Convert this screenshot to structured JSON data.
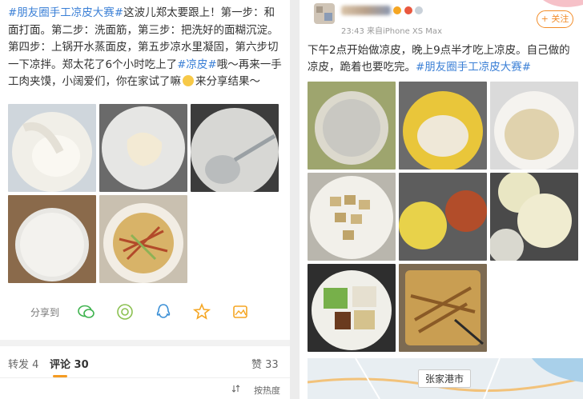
{
  "left_post": {
    "tag": "#朋友圈手工凉皮大赛#",
    "text_1": "这波儿郑太要跟上！第一步：和面打面。第二步：洗面筋，第三步：把洗好的面糊沉淀。第四步：上锅开水蒸面皮，第五步凉水里凝固，第六步切一下凉拌。郑太花了6个小时吃上了",
    "tag_2": "#凉皮#",
    "text_2": "哦～再来一手工肉夹馍，小阔爱们，你在家试了嘛",
    "text_3": "来分享结果～"
  },
  "share": {
    "label": "分享到"
  },
  "tabs": {
    "repost_label": "转发",
    "repost_count": "4",
    "comment_label": "评论",
    "comment_count": "30",
    "like_label": "赞",
    "like_count": "33"
  },
  "sort": {
    "label": "按热度"
  },
  "right_post": {
    "meta": "23:43  来自iPhone XS Max",
    "follow_label": "+ 关注",
    "text_1": "下午2点开始做凉皮，晚上9点半才吃上凉皮。自己做的凉皮，跪着也要吃完。",
    "tag": "#朋友圈手工凉皮大赛#",
    "map_label": "张家港市"
  },
  "colors": {
    "link": "#3a7fd6",
    "accent": "#f59b22",
    "follow": "#f28c28"
  }
}
